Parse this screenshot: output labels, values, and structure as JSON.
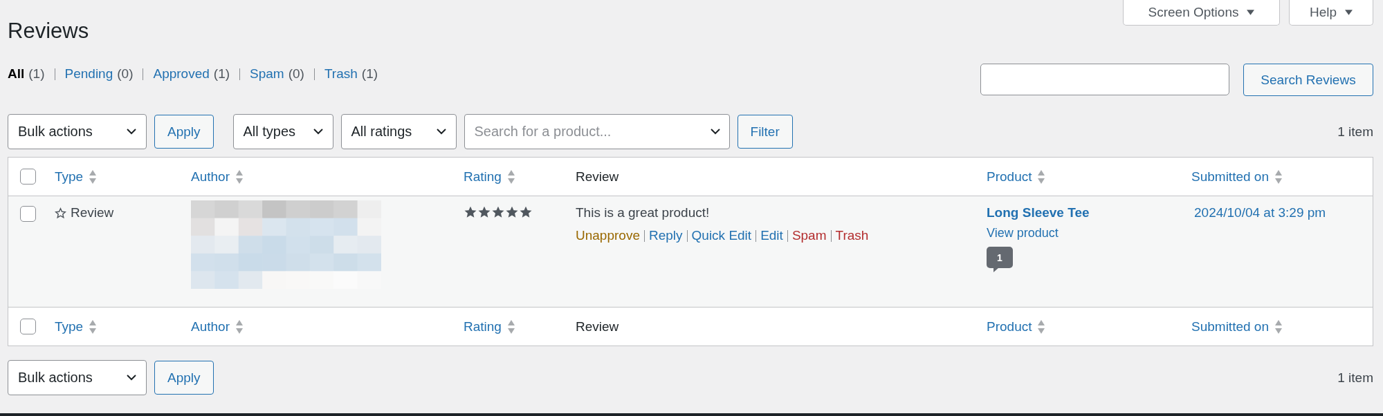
{
  "page_title": "Reviews",
  "header_buttons": [
    {
      "label": "Screen Options"
    },
    {
      "label": "Help"
    }
  ],
  "status_filters": [
    {
      "label": "All",
      "count": "(1)",
      "selected": true
    },
    {
      "label": "Pending",
      "count": "(0)",
      "selected": false
    },
    {
      "label": "Approved",
      "count": "(1)",
      "selected": false
    },
    {
      "label": "Spam",
      "count": "(0)",
      "selected": false
    },
    {
      "label": "Trash",
      "count": "(1)",
      "selected": false
    }
  ],
  "search": {
    "button": "Search Reviews"
  },
  "top_toolbar": {
    "bulk_actions": "Bulk actions",
    "apply": "Apply",
    "type_filter": "All types",
    "rating_filter": "All ratings",
    "product_search": {
      "placeholder": "Search for a product..."
    },
    "filter": "Filter",
    "count": "1 item"
  },
  "header_checkbox": {
    "checked": false
  },
  "columns": [
    {
      "label": "Type",
      "sortable": true
    },
    {
      "label": "Author",
      "sortable": true
    },
    {
      "label": "Rating",
      "sortable": true
    },
    {
      "label": "Review",
      "sortable": false
    },
    {
      "label": "Product",
      "sortable": true
    },
    {
      "label": "Submitted on",
      "sortable": true
    }
  ],
  "rows": [
    {
      "checked": false,
      "type": "Review",
      "stars": 5,
      "review": "This is a great product!",
      "actions": [
        {
          "label": "Unapprove",
          "kind": "warning"
        },
        {
          "label": "Reply",
          "kind": "link"
        },
        {
          "label": "Quick Edit",
          "kind": "link"
        },
        {
          "label": "Edit",
          "kind": "link"
        },
        {
          "label": "Spam",
          "kind": "danger"
        },
        {
          "label": "Trash",
          "kind": "danger"
        }
      ],
      "product": "Long Sleeve Tee",
      "product_link": "View product",
      "comment_count": "1",
      "submitted": "2024/10/04 at 3:29 pm"
    }
  ],
  "footer_checkbox": {
    "checked": false
  },
  "footer_columns": [
    {
      "label": "Type",
      "sortable": true
    },
    {
      "label": "Author",
      "sortable": true
    },
    {
      "label": "Rating",
      "sortable": true
    },
    {
      "label": "Review",
      "sortable": false
    },
    {
      "label": "Product",
      "sortable": true
    },
    {
      "label": "Submitted on",
      "sortable": true
    }
  ],
  "bottom_toolbar": {
    "bulk_actions": "Bulk actions",
    "apply": "Apply",
    "count": "1 item"
  }
}
